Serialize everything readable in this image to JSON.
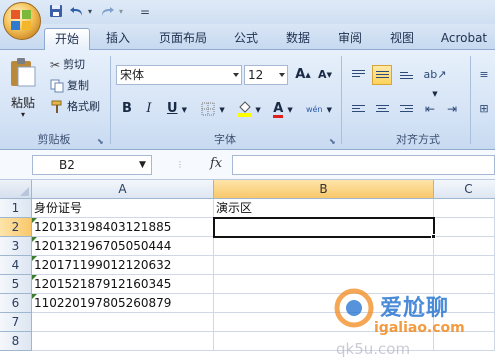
{
  "app": {
    "quick_access": {
      "save": "save-icon",
      "undo": "undo-icon",
      "redo": "redo-icon",
      "customize": "="
    },
    "tabs": [
      "开始",
      "插入",
      "页面布局",
      "公式",
      "数据",
      "审阅",
      "视图",
      "Acrobat"
    ],
    "active_tab": "开始"
  },
  "ribbon": {
    "clipboard": {
      "paste_label": "粘贴",
      "cut_label": "剪切",
      "copy_label": "复制",
      "format_painter_label": "格式刷",
      "group_label": "剪贴板"
    },
    "font": {
      "font_name": "宋体",
      "font_size": "12",
      "bold": "B",
      "italic": "I",
      "underline": "U",
      "grow": "A",
      "shrink": "A",
      "font_color": "A",
      "phonetic": "wén",
      "group_label": "字体"
    },
    "alignment": {
      "group_label": "对齐方式"
    }
  },
  "formula_bar": {
    "name_box": "B2",
    "fx": "fx",
    "content": ""
  },
  "sheet": {
    "columns": [
      "A",
      "B",
      "C"
    ],
    "rows": [
      "1",
      "2",
      "3",
      "4",
      "5",
      "6",
      "7",
      "8"
    ],
    "cells": {
      "A1": "身份证号",
      "B1": "演示区",
      "A2": "120133198403121885",
      "A3": "120132196705050444",
      "A4": "120171199012120632",
      "A5": "120152187912160345",
      "A6": "110220197805260879"
    },
    "selected_cell": "B2"
  },
  "colors": {
    "accent": "#f9c86b",
    "ribbon": "#d3e2f5",
    "grid_line": "#d0d7e5"
  },
  "watermark": {
    "text1": "爱尬聊",
    "text2": "igaliao.com",
    "text3": "qk5u.com"
  }
}
